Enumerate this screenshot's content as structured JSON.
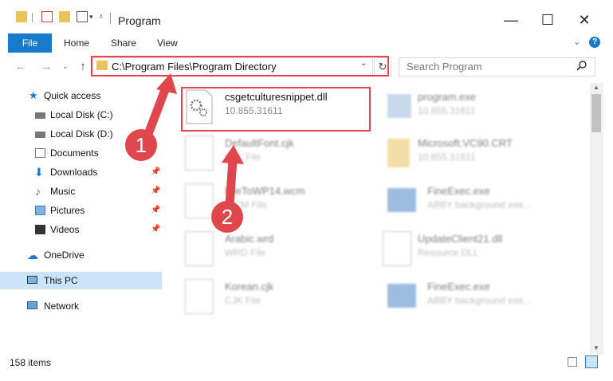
{
  "window": {
    "title": "Program",
    "minimize": "—",
    "maximize": "☐",
    "close": "✕"
  },
  "ribbon": {
    "file": "File",
    "home": "Home",
    "share": "Share",
    "view": "View"
  },
  "address": {
    "path": "C:\\Program Files\\Program Directory",
    "search_placeholder": "Search Program"
  },
  "sidebar": {
    "quick_access": "Quick access",
    "items": [
      {
        "label": "Local Disk (C:)"
      },
      {
        "label": "Local Disk (D:)"
      },
      {
        "label": "Documents"
      },
      {
        "label": "Downloads"
      },
      {
        "label": "Music"
      },
      {
        "label": "Pictures"
      },
      {
        "label": "Videos"
      }
    ],
    "onedrive": "OneDrive",
    "this_pc": "This PC",
    "network": "Network"
  },
  "files": [
    {
      "name": "csgetculturesnippet.dll",
      "sub": "10.855.31611"
    },
    {
      "name": "program.exe",
      "sub": "10.855.31611"
    },
    {
      "name": "DefaultFont.cjk",
      "sub": "CJK File"
    },
    {
      "name": "Microsoft.VC90.CRT",
      "sub": "10.855.31611"
    },
    {
      "name": "FileToWP14.wcm",
      "sub": "WCM File"
    },
    {
      "name": "FineExec.exe",
      "sub": "ABBY background exe..."
    },
    {
      "name": "Arabic.wrd",
      "sub": "WRD File"
    },
    {
      "name": "UpdateClient21.dll",
      "sub": "Resource DLL"
    },
    {
      "name": "Korean.cjk",
      "sub": "CJK File"
    },
    {
      "name": "FineExec.exe",
      "sub": "ABBY background exe..."
    }
  ],
  "status": {
    "count": "158 items"
  },
  "callouts": {
    "one": "1",
    "two": "2"
  },
  "colors": {
    "accent": "#1979ca",
    "highlight": "#e0474c",
    "selected": "#cce4f7"
  }
}
